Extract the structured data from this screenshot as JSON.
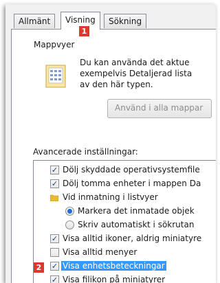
{
  "tabs": [
    {
      "label": "Allmänt"
    },
    {
      "label": "Visning"
    },
    {
      "label": "Sökning"
    }
  ],
  "badges": {
    "one": "1",
    "two": "2"
  },
  "folder_views": {
    "title": "Mappvyer",
    "description_lines": [
      "Du kan använda det aktue",
      "exempelvis Detaljerad lista",
      "av den här typen."
    ],
    "apply_button": "Använd i alla mappar"
  },
  "advanced": {
    "label": "Avancerade inställningar:",
    "items": [
      {
        "type": "checkbox",
        "checked": true,
        "label": "Dölj skyddade operativsystemfile"
      },
      {
        "type": "checkbox",
        "checked": true,
        "label": "Dölj tomma enheter i mappen Da"
      },
      {
        "type": "folder",
        "label": "Vid inmatning i listvyer"
      },
      {
        "type": "radio",
        "checked": true,
        "label": "Markera det inmatade objek"
      },
      {
        "type": "radio",
        "checked": false,
        "label": "Skriv automatiskt i sökrutan"
      },
      {
        "type": "checkbox",
        "checked": true,
        "label": "Visa alltid ikoner, aldrig miniatyre"
      },
      {
        "type": "checkbox",
        "checked": false,
        "label": "Visa alltid menyer"
      },
      {
        "type": "checkbox",
        "checked": true,
        "label": "Visa enhetsbeteckningar",
        "selected": true
      },
      {
        "type": "checkbox",
        "checked": true,
        "label": "Visa filikon på miniatyrer"
      }
    ]
  },
  "colors": {
    "badge": "#d93a2b",
    "selection": "#3399ff",
    "radio_dot": "#1b6fd1"
  }
}
